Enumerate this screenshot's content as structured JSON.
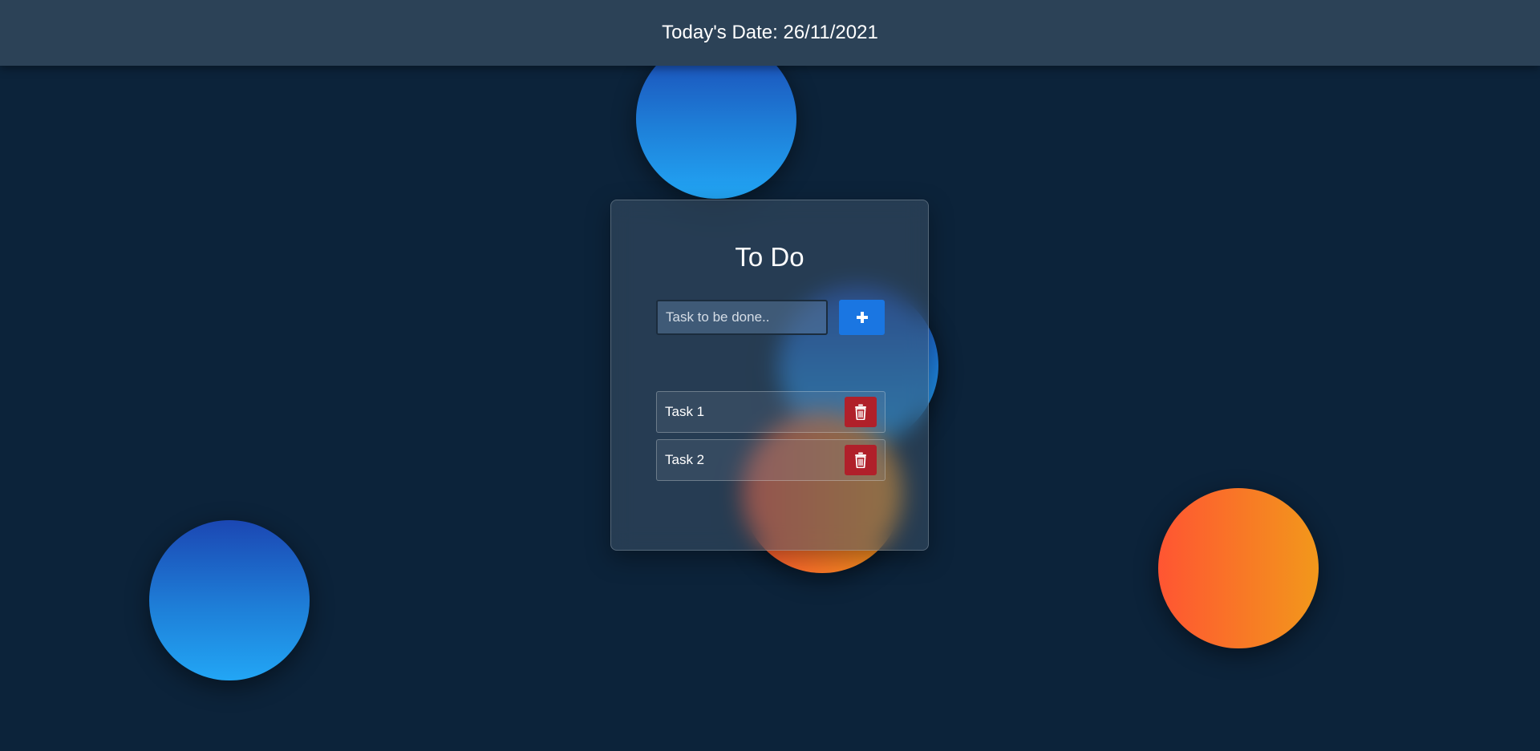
{
  "header": {
    "date_text": "Today's Date: 26/11/2021"
  },
  "todo": {
    "title": "To Do",
    "input": {
      "placeholder": "Task to be done..",
      "value": ""
    },
    "add_icon": "plus-icon",
    "tasks": [
      {
        "label": "Task 1",
        "delete_icon": "trash-icon"
      },
      {
        "label": "Task 2",
        "delete_icon": "trash-icon"
      }
    ]
  },
  "colors": {
    "background": "#0c233a",
    "header": "#2c4257",
    "add_button": "#1a76e2",
    "delete_button": "#b0202a",
    "blob_blue_top": "#1b47b3",
    "blob_blue_bottom": "#22a6f5",
    "blob_orange_left": "#ff5532",
    "blob_orange_right": "#f2981b"
  }
}
